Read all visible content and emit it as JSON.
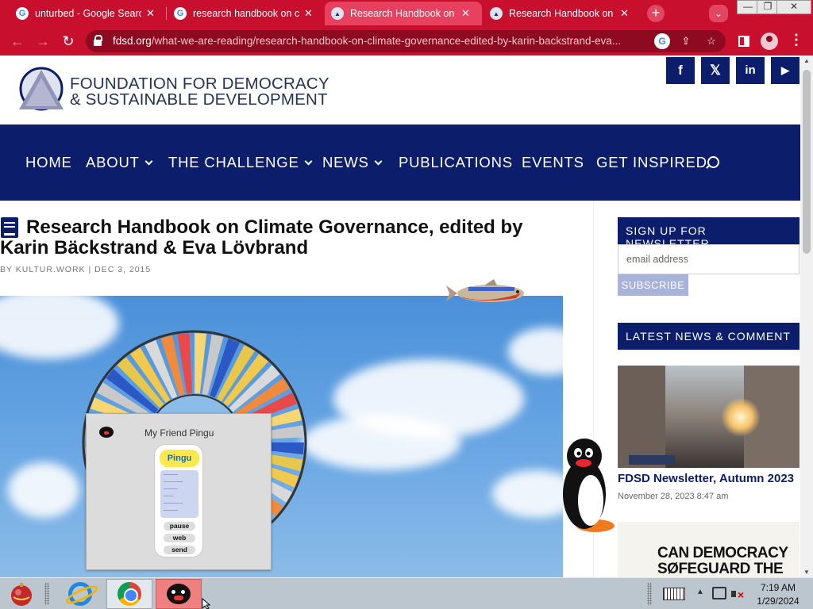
{
  "browser": {
    "tabs": [
      {
        "label": "unturbed - Google Search",
        "icon": "google-icon",
        "active": false
      },
      {
        "label": "research handbook on climate",
        "icon": "google-icon",
        "active": false
      },
      {
        "label": "Research Handbook on Climate",
        "icon": "fdsd-favicon",
        "active": true
      },
      {
        "label": "Research Handbook on Climate",
        "icon": "fdsd-favicon",
        "active": false
      }
    ],
    "url_host": "fdsd.org",
    "url_path": "/what-we-are-reading/research-handbook-on-climate-governance-edited-by-karin-backstrand-eva...",
    "theme_color": "#c8102e"
  },
  "site": {
    "logo_line1": "FOUNDATION FOR DEMOCRACY",
    "logo_line2": "& SUSTAINABLE DEVELOPMENT",
    "social": [
      "f",
      "𝕏",
      "in",
      "▶"
    ],
    "nav": [
      {
        "label": "HOME",
        "dropdown": false
      },
      {
        "label": "ABOUT",
        "dropdown": true
      },
      {
        "label": "THE CHALLENGE",
        "dropdown": true
      },
      {
        "label": "NEWS",
        "dropdown": true
      },
      {
        "label": "PUBLICATIONS",
        "dropdown": false
      },
      {
        "label": "EVENTS",
        "dropdown": false
      },
      {
        "label": "GET INSPIRED",
        "dropdown": false
      }
    ],
    "brand_color": "#0c1e6b"
  },
  "post": {
    "title": "Research Handbook on Climate Governance, edited by Karin Bäckstrand & Eva Lövbrand",
    "meta": "BY KULTUR.WORK | DEC 3, 2015"
  },
  "sidebar": {
    "newsletter_heading": "SIGN UP FOR NEWSLETTER",
    "email_placeholder": "email address",
    "subscribe_label": "SUBSCRIBE",
    "latest_heading": "LATEST NEWS & COMMENT",
    "news_title": "FDSD Newsletter, Autumn 2023",
    "news_date": "November 28, 2023 8:47 am",
    "promo_line1": "CAN DEMOCRACY",
    "promo_line2": "SØFEGUARD THE"
  },
  "pingu": {
    "window_title": "My Friend Pingu",
    "logo": "Pingu",
    "buttons": [
      "pause",
      "web",
      "send"
    ]
  },
  "taskbar": {
    "time": "7:19 AM",
    "date": "1/29/2024"
  }
}
